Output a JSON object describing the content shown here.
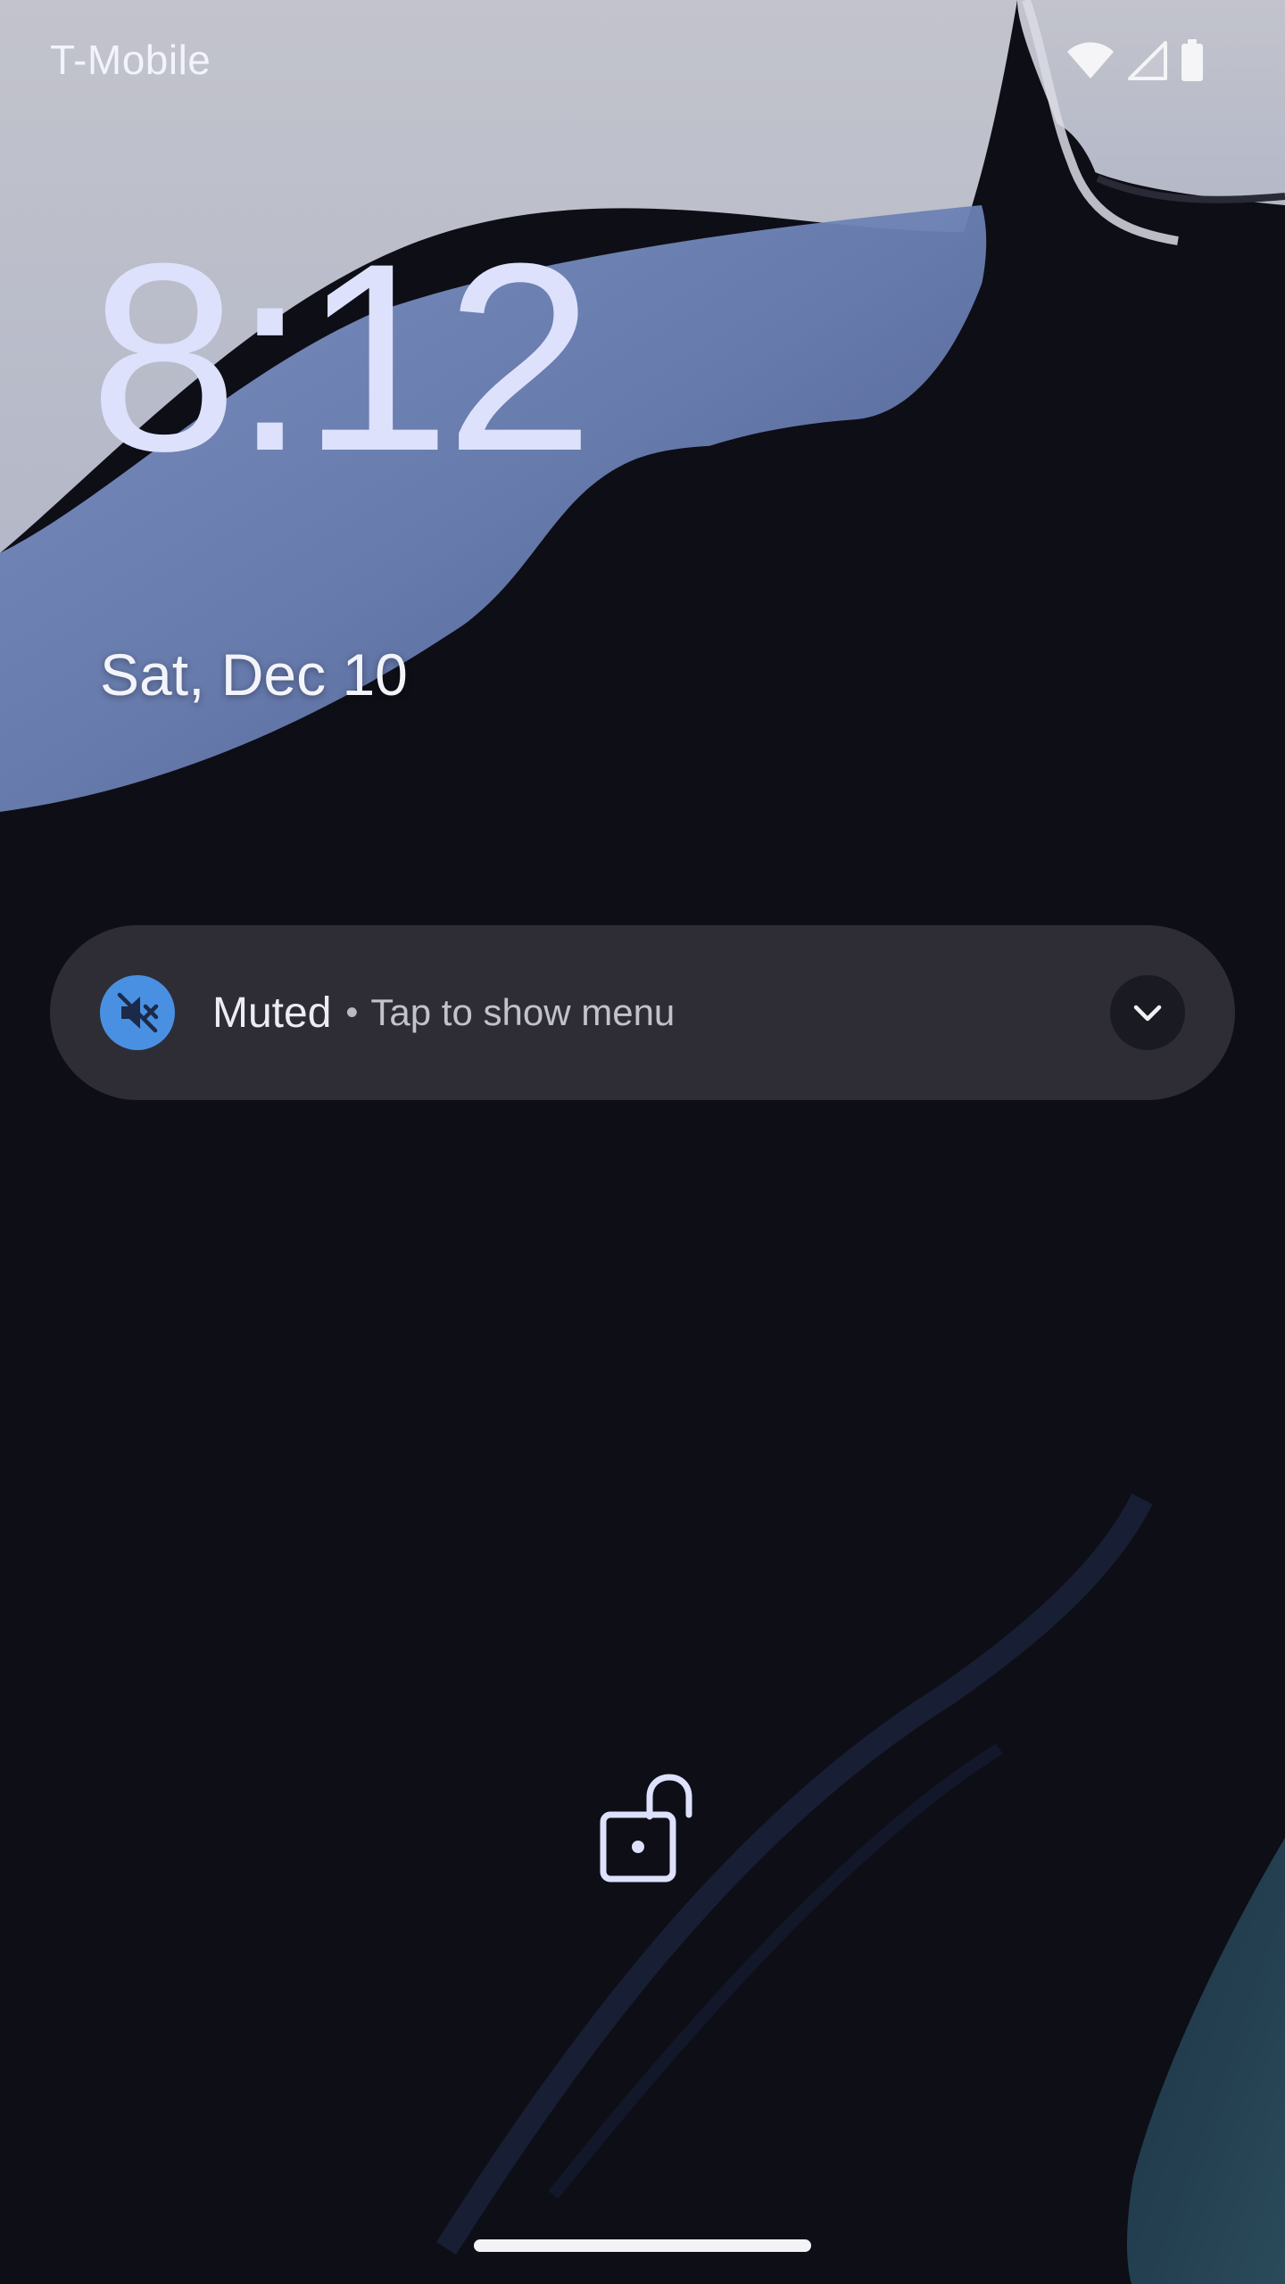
{
  "status_bar": {
    "carrier": "T-Mobile",
    "icons": [
      "wifi-icon",
      "cell-signal-icon",
      "battery-icon"
    ]
  },
  "lockscreen": {
    "time": "8:12",
    "date": "Sat, Dec 10"
  },
  "media_notification": {
    "icon": "volume-off-icon",
    "title": "Muted",
    "separator": "•",
    "subtitle": "Tap to show menu",
    "expand_icon": "chevron-down-icon",
    "accent_color": "#4a90e2"
  },
  "bottom": {
    "lock_icon": "unlock-icon",
    "home_indicator": "home-bar"
  }
}
